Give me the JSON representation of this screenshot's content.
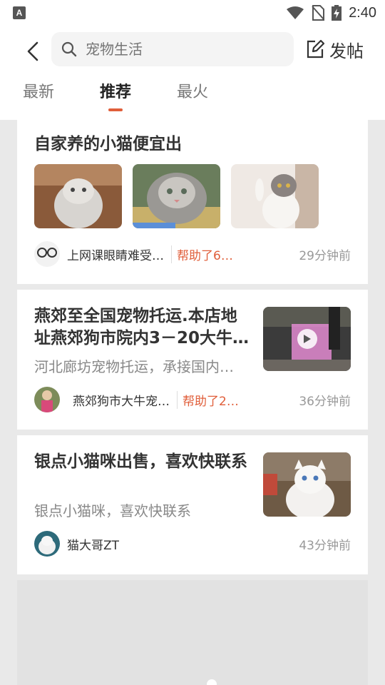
{
  "status_bar": {
    "time": "2:40",
    "left_icon_letter": "A"
  },
  "header": {
    "search_placeholder": "宠物生活",
    "post_label": "发帖"
  },
  "tabs": [
    {
      "label": "最新",
      "active": false
    },
    {
      "label": "推荐",
      "active": true
    },
    {
      "label": "最火",
      "active": false
    }
  ],
  "posts": [
    {
      "title": "自家养的小猫便宜出",
      "author": "上网课眼睛难受…",
      "helped": "帮助了6…",
      "time": "29分钟前"
    },
    {
      "title": "燕郊至全国宠物托运.本店地址燕郊狗市院内3－20大牛…",
      "desc": "河北廊坊宠物托运，承接国内…",
      "author": "燕郊狗市大牛宠…",
      "helped": "帮助了2…",
      "time": "36分钟前"
    },
    {
      "title": "银点小猫咪出售，喜欢快联系",
      "desc": "银点小猫咪，喜欢快联系",
      "author": "猫大哥ZT",
      "time": "43分钟前"
    }
  ],
  "colors": {
    "accent": "#e05e3a",
    "background": "#e9e9e9"
  }
}
